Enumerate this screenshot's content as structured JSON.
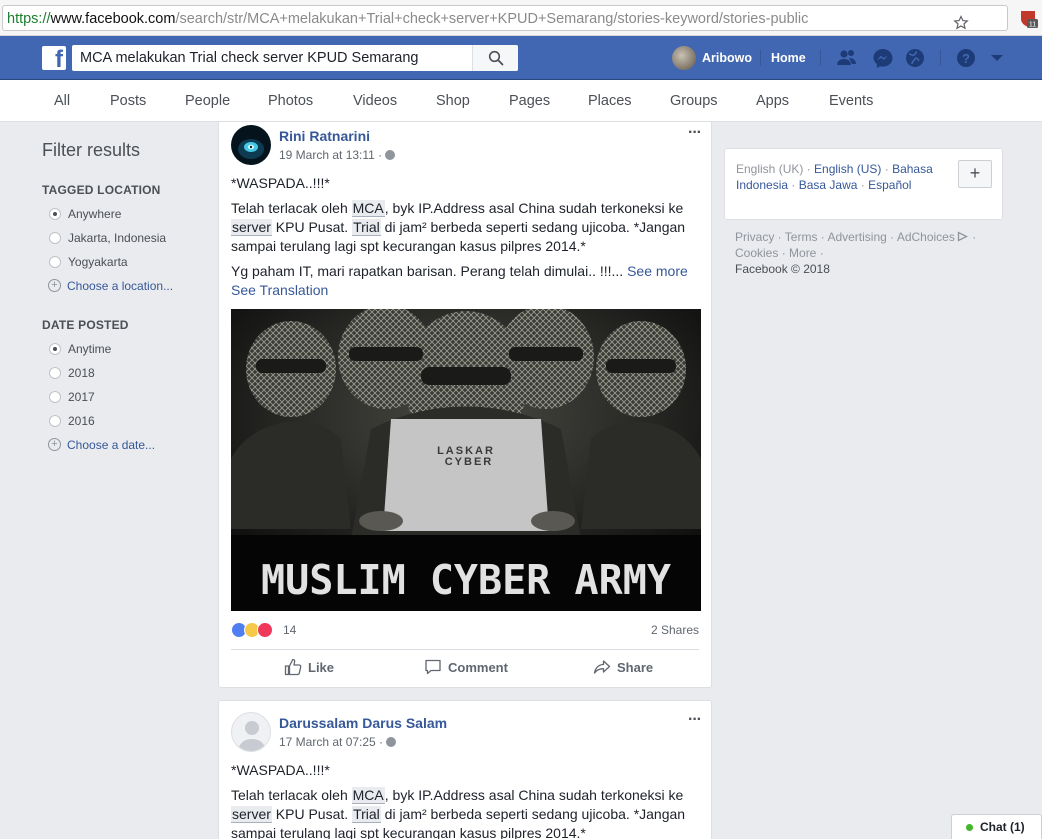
{
  "browser": {
    "url_proto": "https://",
    "url_host": "www.facebook.com",
    "url_path": "/search/str/MCA+melakukan+Trial+check+server+KPUD+Semarang/stories-keyword/stories-public",
    "ext_badge": "11"
  },
  "topbar": {
    "logo": "f",
    "search_value": "MCA melakukan Trial check server KPUD Semarang",
    "user_name": "Aribowo",
    "home_label": "Home"
  },
  "tabs": [
    "All",
    "Posts",
    "People",
    "Photos",
    "Videos",
    "Shop",
    "Pages",
    "Places",
    "Groups",
    "Apps",
    "Events"
  ],
  "filters": {
    "title": "Filter results",
    "location": {
      "heading": "TAGGED LOCATION",
      "options": [
        "Anywhere",
        "Jakarta, Indonesia",
        "Yogyakarta"
      ],
      "choose": "Choose a location..."
    },
    "date": {
      "heading": "DATE POSTED",
      "options": [
        "Anytime",
        "2018",
        "2017",
        "2016"
      ],
      "choose": "Choose a date..."
    }
  },
  "posts": [
    {
      "author": "Rini Ratnarini",
      "date": "19 March at 13:11 ·",
      "line1": "*WASPADA..!!!*",
      "p2_a": "Telah terlacak oleh ",
      "p2_hl1": "MCA",
      "p2_b": ", byk IP.Address asal China sudah terkoneksi ke ",
      "p2_hl2": "server",
      "p2_c": " KPU Pusat. ",
      "p2_hl3": "Trial",
      "p2_d": " di jam² berbeda seperti sedang ujicoba. *Jangan sampai terulang lagi spt kecurangan kasus pilpres 2014.*",
      "p3": "Yg paham IT, mari rapatkan barisan. Perang telah dimulai.. !!!... ",
      "see_more": "See more",
      "see_translation": "See Translation",
      "image_laptop_text_1": "LASKAR",
      "image_laptop_text_2": "CYBER",
      "image_caption": "MUSLIM CYBER ARMY",
      "reactions": "14",
      "shares": "2 Shares",
      "like": "Like",
      "comment": "Comment",
      "share": "Share"
    },
    {
      "author": "Darussalam Darus Salam",
      "date": "17 March at 07:25 ·",
      "line1": "*WASPADA..!!!*",
      "p2_a": "Telah terlacak oleh ",
      "p2_hl1": "MCA",
      "p2_b": ", byk IP.Address asal China sudah terkoneksi ke ",
      "p2_hl2": "server",
      "p2_c": " KPU Pusat. ",
      "p2_hl3": "Trial",
      "p2_d": " di jam² berbeda seperti sedang ujicoba. *Jangan sampai terulang lagi spt kecurangan kasus pilpres 2014.*"
    }
  ],
  "right": {
    "lang_current": "English (UK) · ",
    "lang_1": "English (US)",
    "sep1": " · ",
    "lang_2": "Bahasa Indonesia",
    "sep2": " · ",
    "lang_3": "Basa Jawa",
    "sep3": " · ",
    "lang_4": "Español",
    "add": "+",
    "footer_links": "Privacy · Terms · Advertising · AdChoices",
    "footer_links_2": " · Cookies · More ·",
    "copyright": "Facebook © 2018"
  },
  "chat": {
    "label": "Chat (1)"
  },
  "colors": {
    "brand": "#4267b2",
    "link": "#365899",
    "online": "#42b72a"
  }
}
